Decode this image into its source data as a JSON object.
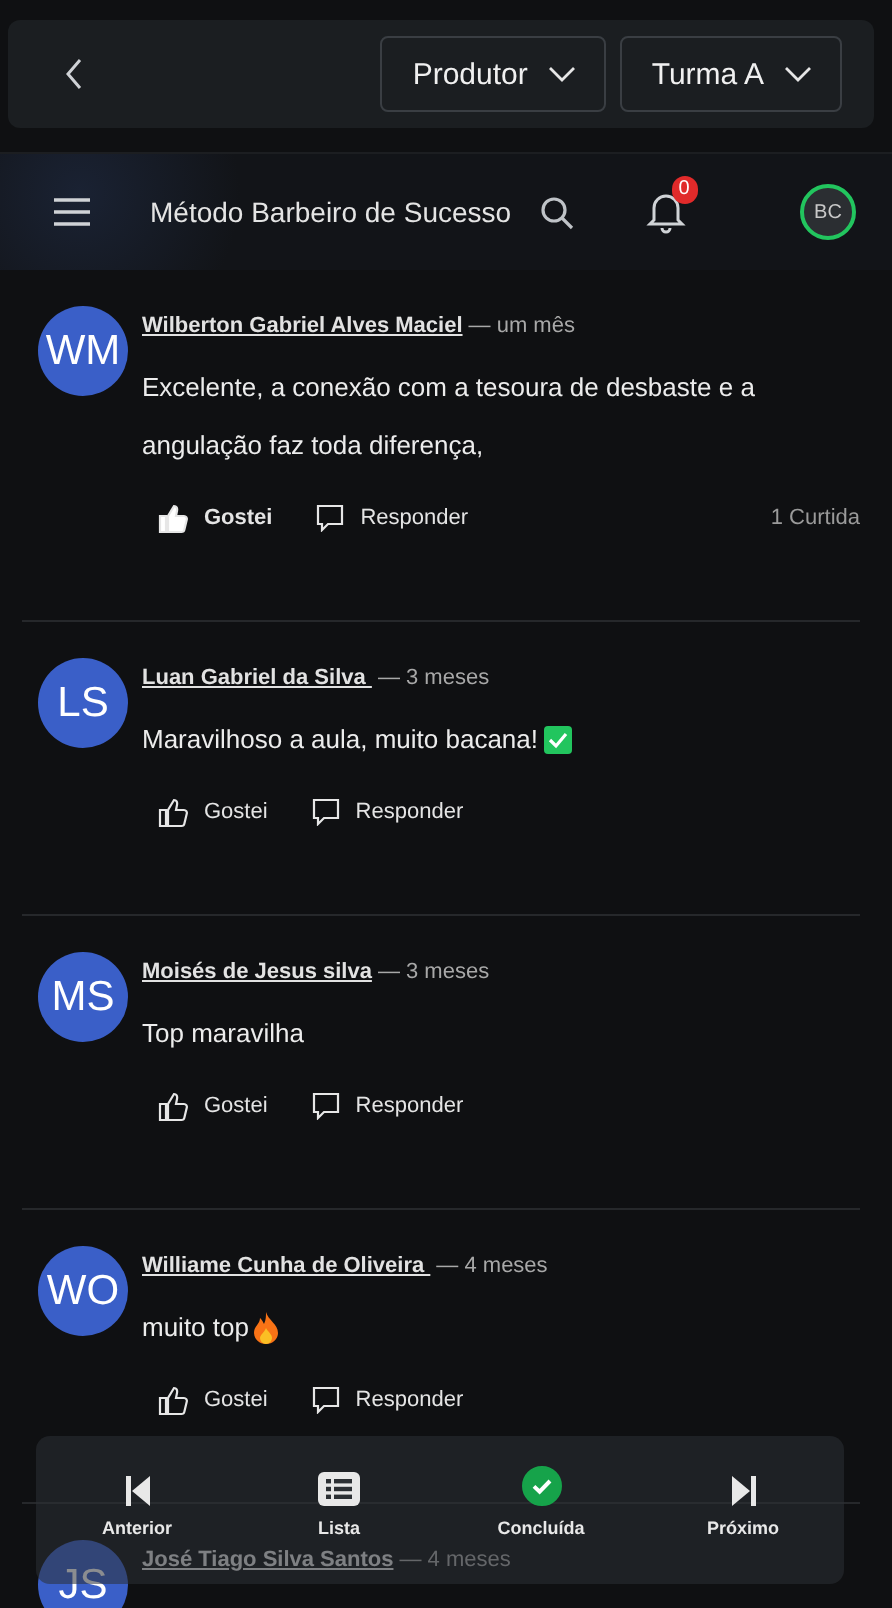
{
  "top_bar": {
    "dropdowns": [
      {
        "label": "Produtor"
      },
      {
        "label": "Turma A"
      }
    ]
  },
  "header": {
    "title": "Método Barbeiro de Sucesso",
    "notifications": "0",
    "user_initials": "BC"
  },
  "comments": [
    {
      "initials": "WM",
      "name": "Wilberton Gabriel Alves Maciel",
      "time": "— um mês",
      "text": "Excelente, a conexão com a tesoura de desbaste e a angulação faz toda diferença,",
      "kind": "plain",
      "liked": true,
      "like_label": "Gostei",
      "reply_label": "Responder",
      "likes": "1 Curtida"
    },
    {
      "initials": "LS",
      "name": "Luan Gabriel da Silva ",
      "time": "— 3 meses",
      "text": "Maravilhoso a aula, muito bacana!",
      "kind": "check",
      "liked": false,
      "like_label": "Gostei",
      "reply_label": "Responder"
    },
    {
      "initials": "MS",
      "name": "Moisés de Jesus silva",
      "time": "— 3 meses",
      "text": "Top maravilha",
      "kind": "plain",
      "liked": false,
      "like_label": "Gostei",
      "reply_label": "Responder"
    },
    {
      "initials": "WO",
      "name": "Williame Cunha de Oliveira ",
      "time": "— 4 meses",
      "text": "muito top",
      "kind": "fire",
      "liked": false,
      "like_label": "Gostei",
      "reply_label": "Responder"
    },
    {
      "initials": "JS",
      "name": "José Tiago Silva Santos",
      "time": "— 4 meses"
    }
  ],
  "bottom_nav": [
    {
      "kind": "prev",
      "label": "Anterior"
    },
    {
      "kind": "list",
      "label": "Lista"
    },
    {
      "kind": "done",
      "label": "Concluída",
      "checked": true
    },
    {
      "kind": "next",
      "label": "Próximo"
    }
  ]
}
